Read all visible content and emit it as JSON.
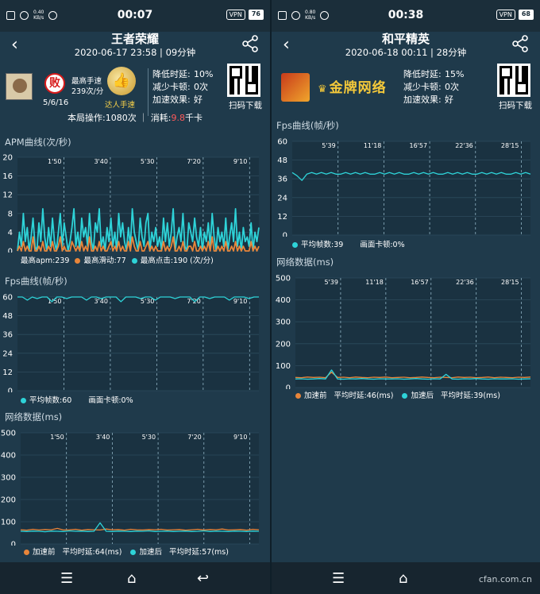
{
  "colors": {
    "cyan": "#2ed3d8",
    "orange": "#e8853a",
    "bg": "#1f3a4b",
    "grid": "#53707f"
  },
  "left": {
    "status": {
      "time": "00:07",
      "speed_top": "0.40",
      "speed_unit": "KB/s",
      "vpn": "VPN",
      "battery": "76"
    },
    "header": {
      "title": "王者荣耀",
      "subtitle": "2020-06-17 23:58 | 09分钟",
      "back_icon": "back-arrow-icon",
      "share_icon": "share-icon"
    },
    "info": {
      "badge": "败",
      "record": "5/6/16",
      "speed_line1": "最高手速",
      "speed_line2": "239次/分",
      "medal_label": "达人手速",
      "latency_label": "降低时延:",
      "latency_value": "10%",
      "lag_label": "减少卡顿:",
      "lag_value": "0次",
      "effect_label": "加速效果:",
      "effect_value": "好",
      "qr_label": "扫码下载",
      "summary_a": "本局操作:1080次 ｜ 消耗:",
      "summary_red": "9.8",
      "summary_b": "千卡"
    },
    "apm": {
      "title": "APM曲线(次/秒)",
      "legend_a": "最高apm:239",
      "legend_b": "最高滑动:77",
      "legend_c": "最高点击:190 (次/分)"
    },
    "fps": {
      "title": "Fps曲线(帧/秒)",
      "legend_a": "平均帧数:60",
      "legend_b": "画面卡顿:0%"
    },
    "net": {
      "title": "网络数据(ms)",
      "legend_a": "加速前",
      "legend_b": "平均时延:64(ms)",
      "legend_c": "加速后",
      "legend_d": "平均时延:57(ms)"
    }
  },
  "right": {
    "status": {
      "time": "00:38",
      "speed_top": "0.80",
      "speed_unit": "KB/s",
      "vpn": "VPN",
      "battery": "68"
    },
    "header": {
      "title": "和平精英",
      "subtitle": "2020-06-18 00:11 | 28分钟",
      "back_icon": "back-arrow-icon",
      "share_icon": "share-icon"
    },
    "info": {
      "brand": "金牌网络",
      "latency_label": "降低时延:",
      "latency_value": "15%",
      "lag_label": "减少卡顿:",
      "lag_value": "0次",
      "effect_label": "加速效果:",
      "effect_value": "好",
      "qr_label": "扫码下载"
    },
    "fps": {
      "title": "Fps曲线(帧/秒)",
      "legend_a": "平均帧数:39",
      "legend_b": "画面卡顿:0%"
    },
    "net": {
      "title": "网络数据(ms)",
      "legend_a": "加速前",
      "legend_b": "平均时延:46(ms)",
      "legend_c": "加速后",
      "legend_d": "平均时延:39(ms)"
    }
  },
  "nav": {
    "menu_icon": "menu-icon",
    "home_icon": "home-icon",
    "back_icon": "return-icon"
  },
  "watermark": "cfan.com.cn",
  "chart_data": [
    {
      "id": "left-apm",
      "type": "line",
      "title": "APM曲线(次/秒)",
      "ylim": [
        0,
        20
      ],
      "yticks": [
        0,
        4,
        8,
        12,
        16,
        20
      ],
      "xticks": [
        "1'50",
        "3'40",
        "5'30",
        "7'20",
        "9'10"
      ],
      "series": [
        {
          "name": "最高点击",
          "color": "#2ed3d8",
          "values": [
            0,
            4,
            1,
            8,
            2,
            5,
            0,
            3,
            7,
            1,
            0,
            6,
            2,
            9,
            3,
            0,
            5,
            1,
            7,
            2,
            0,
            4,
            8,
            1,
            6,
            3,
            0,
            2,
            5,
            9,
            1,
            4,
            0,
            7,
            3,
            5,
            1,
            8,
            2,
            0,
            6,
            4,
            9,
            1,
            3,
            0,
            5,
            2,
            7,
            1,
            4,
            0,
            8,
            3,
            6,
            2,
            0,
            5,
            1,
            9,
            4,
            2,
            0,
            7,
            3,
            1,
            6,
            8,
            0,
            4,
            2,
            5,
            1,
            3,
            0,
            7,
            2,
            6,
            1,
            4,
            9,
            0,
            3,
            5,
            2,
            8,
            1,
            0,
            6,
            4,
            2,
            7,
            3,
            1,
            5,
            0,
            4,
            2,
            6,
            1,
            8,
            3,
            0,
            5,
            2,
            4,
            1,
            7,
            0,
            3,
            6,
            2,
            9,
            1,
            4,
            0,
            5,
            2,
            3,
            1,
            6,
            0,
            4,
            2,
            5
          ]
        },
        {
          "name": "最高滑动",
          "color": "#e8853a",
          "values": [
            0,
            1,
            0,
            2,
            0,
            1,
            0,
            0,
            3,
            0,
            0,
            1,
            0,
            2,
            0,
            0,
            1,
            0,
            2,
            0,
            0,
            1,
            3,
            0,
            1,
            0,
            0,
            0,
            2,
            1,
            0,
            1,
            0,
            2,
            0,
            1,
            0,
            3,
            0,
            0,
            1,
            0,
            2,
            0,
            1,
            0,
            0,
            1,
            2,
            0,
            1,
            0,
            2,
            0,
            1,
            0,
            0,
            2,
            0,
            3,
            1,
            0,
            0,
            2,
            0,
            0,
            1,
            2,
            0,
            1,
            0,
            1,
            0,
            0,
            0,
            2,
            0,
            1,
            0,
            1,
            3,
            0,
            0,
            1,
            0,
            2,
            0,
            0,
            1,
            1,
            0,
            2,
            0,
            0,
            1,
            0,
            1,
            0,
            2,
            0,
            3,
            0,
            0,
            1,
            0,
            1,
            0,
            2,
            0,
            0,
            1,
            0,
            2,
            0,
            1,
            0,
            1,
            0,
            0,
            0,
            2,
            0,
            1,
            0,
            1
          ]
        }
      ]
    },
    {
      "id": "left-fps",
      "type": "line",
      "title": "Fps曲线(帧/秒)",
      "ylim": [
        0,
        60
      ],
      "yticks": [
        0,
        12,
        24,
        36,
        48,
        60
      ],
      "xticks": [
        "1'50",
        "3'40",
        "5'30",
        "7'20",
        "9'10"
      ],
      "series": [
        {
          "name": "平均帧数",
          "color": "#2ed3d8",
          "values": [
            60,
            60,
            58,
            60,
            59,
            60,
            60,
            57,
            60,
            60,
            59,
            60,
            60,
            60,
            58,
            60,
            60,
            59,
            60,
            60,
            60,
            57,
            60,
            60,
            60,
            59,
            60,
            60,
            58,
            60,
            60,
            60,
            59,
            60,
            60,
            60,
            57,
            60,
            60,
            59,
            60,
            60,
            60,
            58,
            60,
            60,
            60,
            59,
            60,
            60
          ]
        }
      ]
    },
    {
      "id": "left-net",
      "type": "line",
      "title": "网络数据(ms)",
      "ylim": [
        0,
        500
      ],
      "yticks": [
        0,
        100,
        200,
        300,
        400,
        500
      ],
      "xticks": [
        "1'50",
        "3'40",
        "5'30",
        "7'20",
        "9'10"
      ],
      "series": [
        {
          "name": "加速前",
          "color": "#e8853a",
          "values": [
            64,
            62,
            66,
            63,
            65,
            64,
            70,
            63,
            64,
            66,
            62,
            65,
            64,
            63,
            67,
            64,
            65,
            62,
            66,
            64,
            63,
            65,
            64,
            66,
            63,
            64,
            65,
            62,
            64,
            66,
            63,
            65,
            64,
            67,
            63,
            64,
            65,
            62,
            66,
            64
          ]
        },
        {
          "name": "加速后",
          "color": "#2ed3d8",
          "values": [
            57,
            56,
            58,
            57,
            55,
            58,
            57,
            56,
            59,
            57,
            58,
            56,
            57,
            95,
            57,
            56,
            58,
            57,
            56,
            58,
            57,
            59,
            56,
            57,
            58,
            56,
            57,
            58,
            56,
            57,
            59,
            56,
            58,
            57,
            56,
            58,
            57,
            56,
            58,
            57
          ]
        }
      ]
    },
    {
      "id": "right-fps",
      "type": "line",
      "title": "Fps曲线(帧/秒)",
      "ylim": [
        0,
        60
      ],
      "yticks": [
        0,
        12,
        24,
        36,
        48,
        60
      ],
      "xticks": [
        "5'39",
        "11'18",
        "16'57",
        "22'36",
        "28'15"
      ],
      "series": [
        {
          "name": "平均帧数",
          "color": "#2ed3d8",
          "values": [
            40,
            38,
            35,
            39,
            40,
            39,
            40,
            39,
            40,
            39,
            39,
            40,
            39,
            40,
            39,
            40,
            39,
            39,
            40,
            39,
            40,
            39,
            40,
            39,
            39,
            40,
            39,
            40,
            39,
            40,
            39,
            39,
            40,
            39,
            40,
            39,
            40,
            39,
            39,
            40,
            39,
            40,
            39,
            40,
            39,
            39,
            40,
            39,
            40,
            39
          ]
        }
      ]
    },
    {
      "id": "right-net",
      "type": "line",
      "title": "网络数据(ms)",
      "ylim": [
        0,
        500
      ],
      "yticks": [
        0,
        100,
        200,
        300,
        400,
        500
      ],
      "xticks": [
        "5'39",
        "11'18",
        "16'57",
        "22'36",
        "28'15"
      ],
      "series": [
        {
          "name": "加速前",
          "color": "#e8853a",
          "values": [
            46,
            45,
            48,
            46,
            47,
            45,
            70,
            46,
            47,
            45,
            48,
            46,
            45,
            47,
            46,
            48,
            45,
            46,
            47,
            45,
            46,
            48,
            46,
            45,
            47,
            46,
            45,
            48,
            46,
            47,
            45,
            46,
            48,
            45,
            47,
            46,
            45,
            47,
            46,
            48
          ]
        },
        {
          "name": "加速后",
          "color": "#2ed3d8",
          "values": [
            39,
            40,
            38,
            39,
            41,
            39,
            80,
            39,
            38,
            40,
            39,
            41,
            39,
            38,
            40,
            39,
            39,
            40,
            38,
            39,
            41,
            39,
            38,
            40,
            39,
            60,
            39,
            38,
            40,
            39,
            41,
            39,
            38,
            40,
            39,
            39,
            40,
            38,
            39,
            40
          ]
        }
      ]
    }
  ]
}
